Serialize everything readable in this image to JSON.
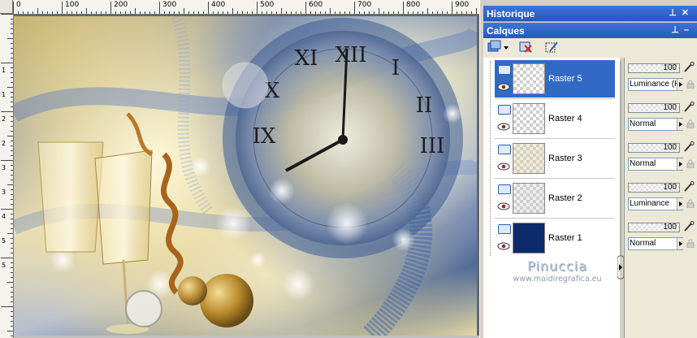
{
  "rulers": {
    "horizontal_labels": [
      "0",
      "100",
      "200",
      "300",
      "400",
      "500",
      "600",
      "700",
      "800",
      "900"
    ],
    "vertical_labels": [
      "1",
      "1",
      "2",
      "2",
      "3",
      "3",
      "4",
      "5",
      "5"
    ]
  },
  "panels": {
    "history_title": "Historique",
    "layers_title": "Calques"
  },
  "layers": [
    {
      "name": "Raster 5",
      "opacity": "100",
      "blend": "Luminance (H)",
      "selected": true
    },
    {
      "name": "Raster 4",
      "opacity": "100",
      "blend": "Normal",
      "selected": false
    },
    {
      "name": "Raster 3",
      "opacity": "100",
      "blend": "Normal",
      "selected": false
    },
    {
      "name": "Raster 2",
      "opacity": "100",
      "blend": "Luminance",
      "selected": false
    },
    {
      "name": "Raster 1",
      "opacity": "100",
      "blend": "Normal",
      "selected": false
    }
  ],
  "watermark": {
    "name": "Pinuccia",
    "url": "www.maidiregrafica.eu"
  },
  "colors": {
    "title_bar": "#2558c0",
    "selection": "#316ac5",
    "raster1_fill": "#0b2a6b"
  }
}
